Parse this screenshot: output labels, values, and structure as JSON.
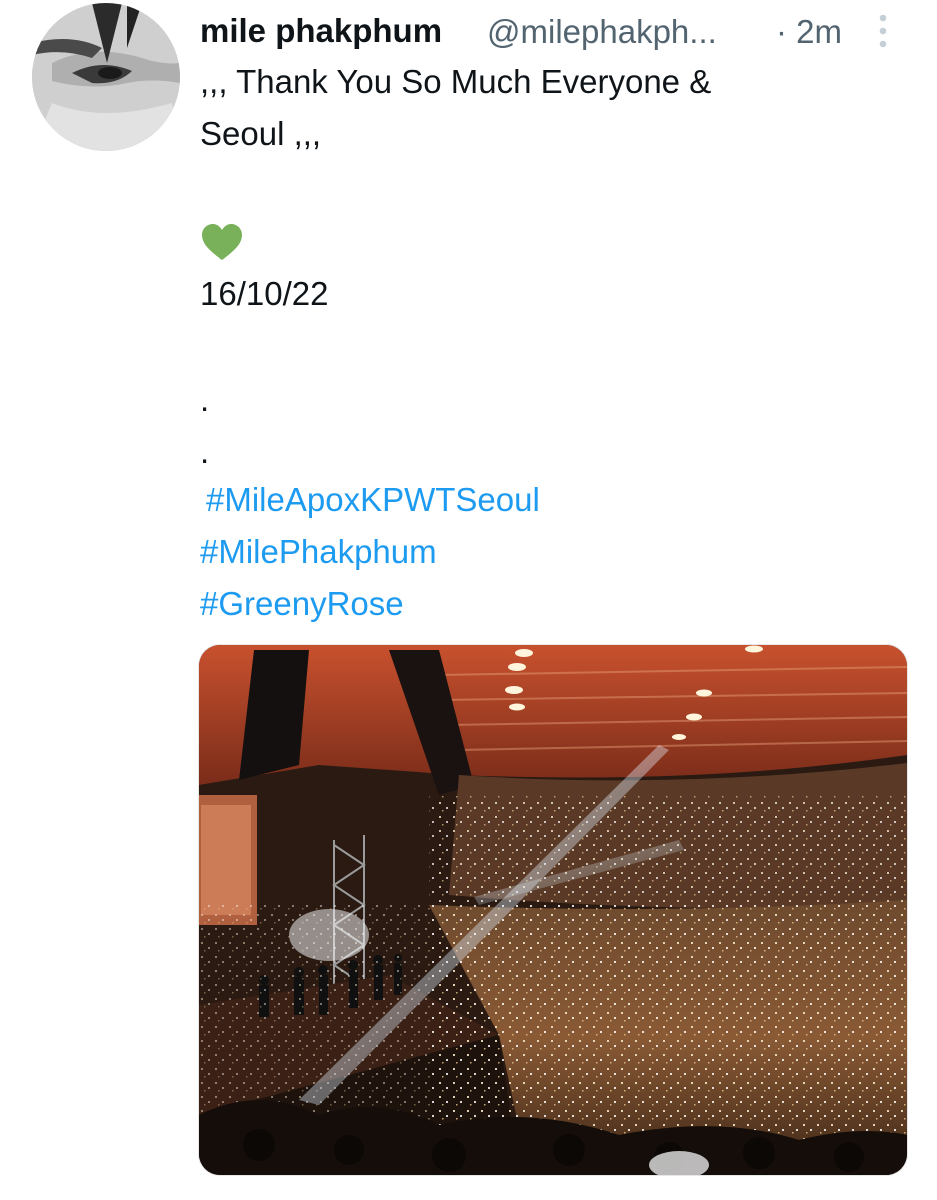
{
  "tweet": {
    "author": {
      "display_name": "mile phakphum",
      "handle": "@milephakph...",
      "avatar_icon": "profile-photo"
    },
    "separator": "·",
    "time": "2m",
    "more_icon": "vertical-ellipsis-icon",
    "body": {
      "line1": ",,, Thank You So Much Everyone &",
      "line2": "Seoul ,,,",
      "emoji_icon": "green-heart-icon",
      "date": "16/10/22",
      "dot1": ".",
      "dot2": ".",
      "hashtags": [
        "#MileApoxKPWTSeoul",
        "#MilePhakphum",
        "#GreenyRose"
      ]
    },
    "media": {
      "icon": "concert-photo"
    }
  },
  "colors": {
    "link": "#1d9bf0",
    "secondary_text": "#536471",
    "heart": "#78b159"
  }
}
